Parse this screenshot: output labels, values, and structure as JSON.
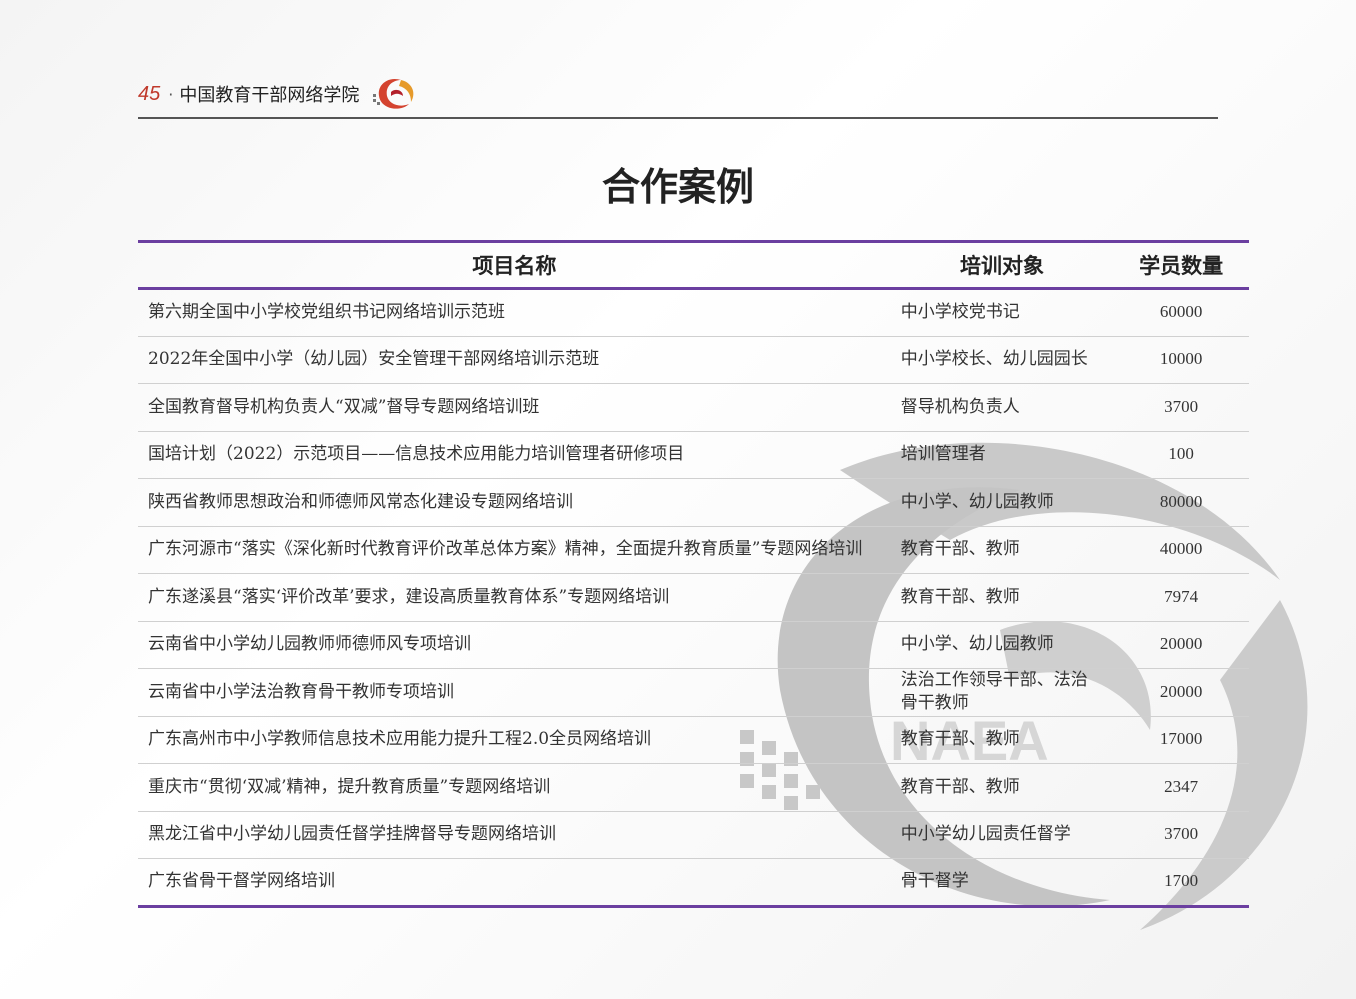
{
  "header": {
    "page_number": "45",
    "separator": "·",
    "org_name": "中国教育干部网络学院",
    "logo_icon": "naea-swirl-logo-icon",
    "accent_color": "#c0392b"
  },
  "title": "合作案例",
  "table": {
    "columns": [
      "项目名称",
      "培训对象",
      "学员数量"
    ],
    "rule_color": "#6b3fa0",
    "rows": [
      {
        "name": "第六期全国中小学校党组织书记网络培训示范班",
        "target": "中小学校党书记",
        "count": "60000"
      },
      {
        "name": "2022年全国中小学（幼儿园）安全管理干部网络培训示范班",
        "target": "中小学校长、幼儿园园长",
        "count": "10000"
      },
      {
        "name": "全国教育督导机构负责人“双减”督导专题网络培训班",
        "target": "督导机构负责人",
        "count": "3700"
      },
      {
        "name": "国培计划（2022）示范项目——信息技术应用能力培训管理者研修项目",
        "target": "培训管理者",
        "count": "100"
      },
      {
        "name": "陕西省教师思想政治和师德师风常态化建设专题网络培训",
        "target": "中小学、幼儿园教师",
        "count": "80000"
      },
      {
        "name": "广东河源市“落实《深化新时代教育评价改革总体方案》精神，全面提升教育质量”专题网络培训",
        "target": "教育干部、教师",
        "count": "40000"
      },
      {
        "name": "广东遂溪县“落实‘评价改革’要求，建设高质量教育体系”专题网络培训",
        "target": "教育干部、教师",
        "count": "7974"
      },
      {
        "name": "云南省中小学幼儿园教师师德师风专项培训",
        "target": "中小学、幼儿园教师",
        "count": "20000"
      },
      {
        "name": "云南省中小学法治教育骨干教师专项培训",
        "target": "法治工作领导干部、法治骨干教师",
        "count": "20000"
      },
      {
        "name": "广东高州市中小学教师信息技术应用能力提升工程2.0全员网络培训",
        "target": "教育干部、教师",
        "count": "17000"
      },
      {
        "name": "重庆市“贯彻‘双减’精神，提升教育质量”专题网络培训",
        "target": "教育干部、教师",
        "count": "2347"
      },
      {
        "name": "黑龙江省中小学幼儿园责任督学挂牌督导专题网络培训",
        "target": "中小学幼儿园责任督学",
        "count": "3700"
      },
      {
        "name": "广东省骨干督学网络培训",
        "target": "骨干督学",
        "count": "1700"
      }
    ]
  },
  "watermark": {
    "icon": "naea-watermark-swirl-icon",
    "text": "NAEA"
  }
}
